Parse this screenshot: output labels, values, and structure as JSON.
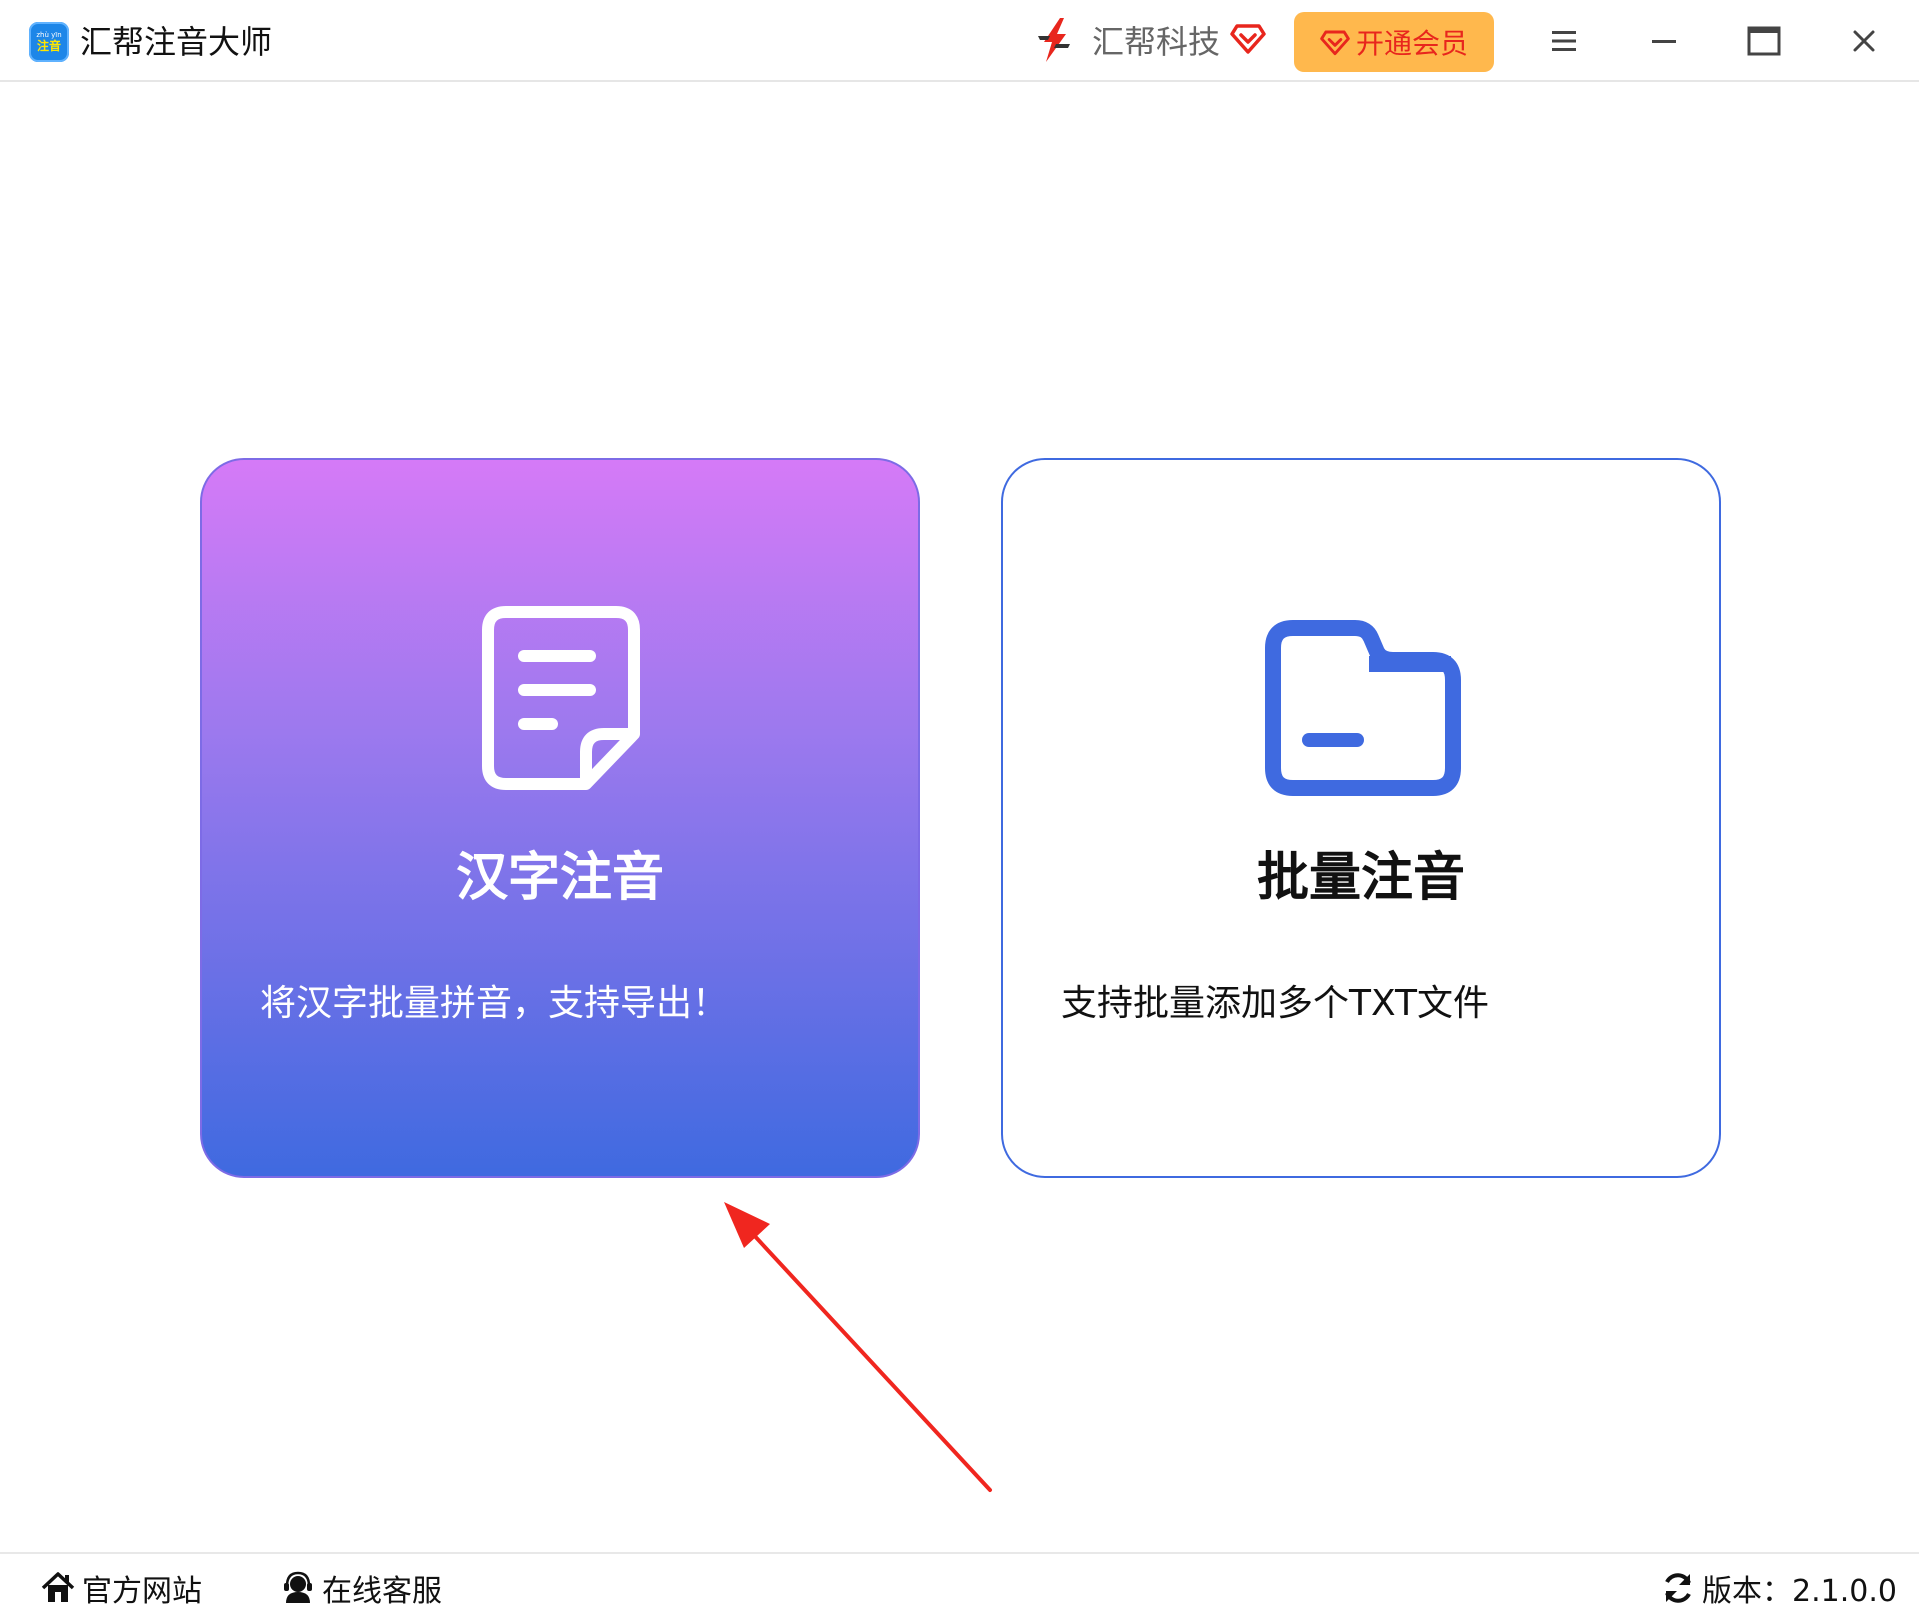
{
  "app": {
    "title": "汇帮注音大师",
    "logo_pinyin": "zhù yīn",
    "logo_text": "注音"
  },
  "header": {
    "brand_name": "汇帮科技",
    "vip_button": "开通会员"
  },
  "cards": [
    {
      "title": "汉字注音",
      "description": "将汉字批量拼音，支持导出！",
      "icon": "document-icon"
    },
    {
      "title": "批量注音",
      "description": "支持批量添加多个TXT文件",
      "icon": "folder-icon"
    }
  ],
  "footer": {
    "website": "官方网站",
    "service": "在线客服",
    "version": "版本：2.1.0.0"
  },
  "colors": {
    "accent_blue": "#3f6ae0",
    "gradient_top": "#d57af7",
    "gradient_bottom": "#3f6ae0",
    "vip_bg": "#ffb84d",
    "vip_text": "#e8261d",
    "arrow": "#f0261f"
  }
}
